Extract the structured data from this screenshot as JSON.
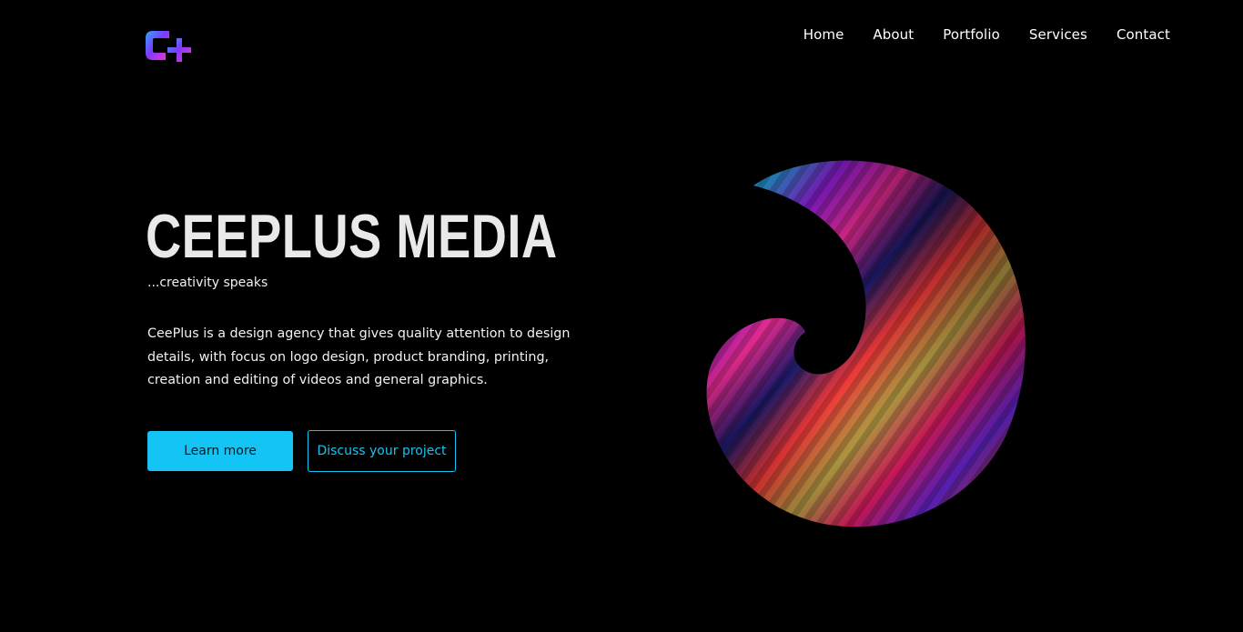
{
  "brand": {
    "logo_icon": "ceeplus-logo-icon",
    "accent": "#14c4f5",
    "logo_colors": [
      "#ff2fd0",
      "#7a3cff",
      "#2fa8ff"
    ]
  },
  "nav": {
    "items": [
      {
        "label": "Home"
      },
      {
        "label": "About"
      },
      {
        "label": "Portfolio"
      },
      {
        "label": "Services"
      },
      {
        "label": "Contact"
      }
    ]
  },
  "hero": {
    "title": "CEEPLUS MEDIA",
    "tagline": "...creativity speaks",
    "description": "CeePlus is a design agency that gives quality attention to design details, with focus on logo design, product branding, printing, creation and editing of videos and general graphics.",
    "primary_button": "Learn more",
    "secondary_button": "Discuss your project",
    "art_icon": "abstract-swirl-artwork"
  },
  "colors": {
    "background": "#000000",
    "title": "#e9e9e9",
    "text": "#ffffff"
  }
}
